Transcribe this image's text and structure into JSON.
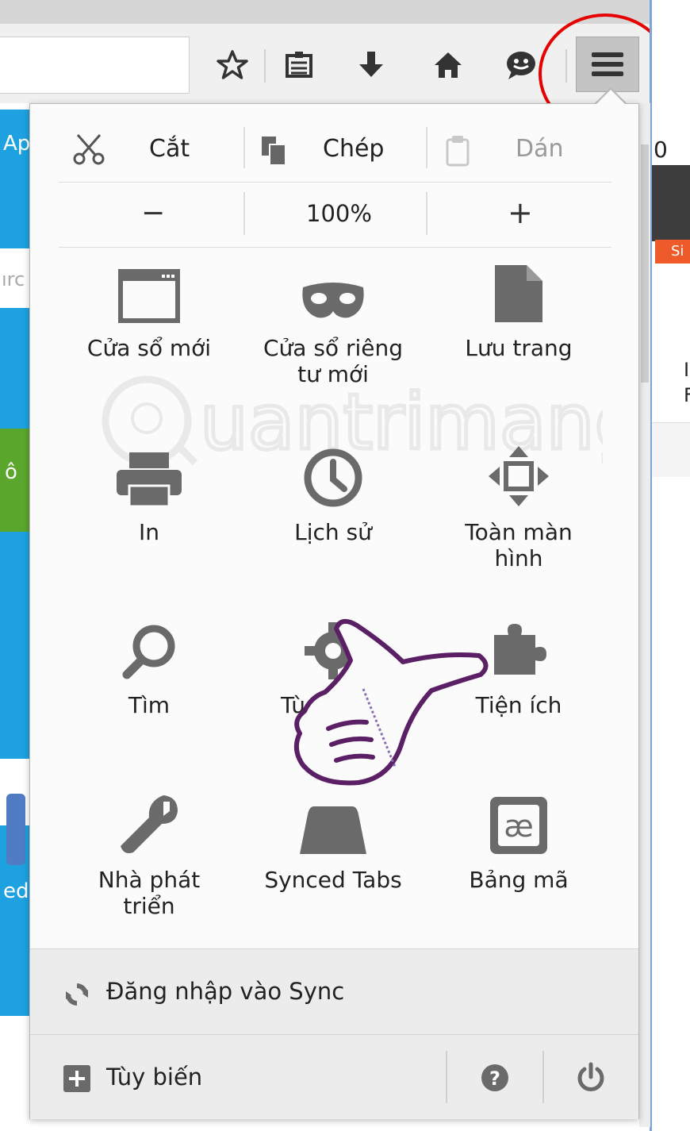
{
  "toolbar": {
    "icons": [
      "bookmark-star-icon",
      "reading-list-icon",
      "download-icon",
      "home-icon",
      "chat-icon",
      "hamburger-menu-icon"
    ]
  },
  "background_page": {
    "left_fragments": [
      "Ap",
      "ırc",
      "ô",
      "ed"
    ],
    "right_fragments": [
      "0",
      "Si",
      "I",
      "F"
    ]
  },
  "menu": {
    "edit": {
      "cut": "Cắt",
      "copy": "Chép",
      "paste": "Dán"
    },
    "zoom": {
      "minus": "−",
      "level": "100%",
      "plus": "+"
    },
    "grid": [
      {
        "label": "Cửa sổ mới",
        "icon": "new-window-icon"
      },
      {
        "label": "Cửa sổ riêng tư mới",
        "icon": "private-mask-icon"
      },
      {
        "label": "Lưu trang",
        "icon": "save-page-icon"
      },
      {
        "label": "In",
        "icon": "print-icon"
      },
      {
        "label": "Lịch sử",
        "icon": "history-clock-icon"
      },
      {
        "label": "Toàn màn hình",
        "icon": "fullscreen-icon"
      },
      {
        "label": "Tìm",
        "icon": "find-magnifier-icon"
      },
      {
        "label": "Tù",
        "icon": "options-gear-icon"
      },
      {
        "label": "Tiện ích",
        "icon": "addons-puzzle-icon"
      },
      {
        "label": "Nhà phát triển",
        "icon": "developer-wrench-icon"
      },
      {
        "label": "Synced Tabs",
        "icon": "synced-tabs-icon"
      },
      {
        "label": "Bảng mã",
        "icon": "encoding-ae-icon"
      }
    ],
    "sync": "Đăng nhập vào Sync",
    "customize": "Tùy biến",
    "help_icon": "help-icon",
    "quit_icon": "power-icon"
  },
  "colors": {
    "highlight_circle": "#e60000",
    "icon_gray": "#6a6a6a",
    "pointer_outline": "#5b1f66"
  },
  "watermark": "Quantrimang"
}
